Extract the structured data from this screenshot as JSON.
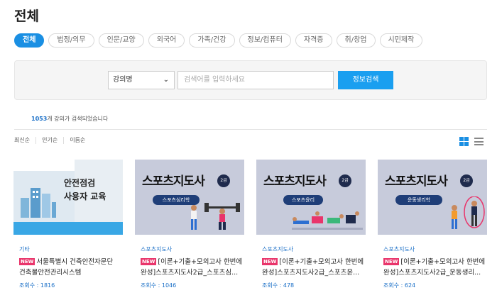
{
  "page_title": "전체",
  "tabs": [
    "전체",
    "법정/의무",
    "인문/교양",
    "외국어",
    "가족/건강",
    "정보/컴퓨터",
    "자격증",
    "취/창업",
    "시민제작"
  ],
  "search": {
    "select_value": "강의명",
    "input_placeholder": "검색어를 입력하세요",
    "button_label": "정보검색"
  },
  "result": {
    "count": "1053",
    "suffix": "개 강의가 검색되었습니다"
  },
  "sort_options": [
    "최신순",
    "인기순",
    "이름순"
  ],
  "cards": [
    {
      "thumb": {
        "line1": "안전점검",
        "line2": "사용자 교육"
      },
      "category": "기타",
      "new_badge": "NEW",
      "title": "서울특별시 건축안전자문단 건축물안전관리시스템",
      "views": "조회수 : 1816"
    },
    {
      "thumb": {
        "headline": "스포츠지도사",
        "grade": "2급",
        "pill": "스포츠심리학"
      },
      "category": "스포츠지도사",
      "new_badge": "NEW",
      "title": "[이론+기출+모의고사 한번에 완성]스포츠지도사2급_스포츠심...",
      "views": "조회수 : 1046"
    },
    {
      "thumb": {
        "headline": "스포츠지도사",
        "grade": "2급",
        "pill": "스포츠윤리"
      },
      "category": "스포츠지도사",
      "new_badge": "NEW",
      "title": "[이론+기출+모의고사 한번에 완성]스포츠지도사2급_스포츠윤...",
      "views": "조회수 : 478"
    },
    {
      "thumb": {
        "headline": "스포츠지도사",
        "grade": "2급",
        "pill": "운동생리학"
      },
      "category": "스포츠지도사",
      "new_badge": "NEW",
      "title": "[이론+기출+모의고사 한번에 완성]스포츠지도사2급_운동생리...",
      "views": "조회수 : 624"
    }
  ],
  "colors": {
    "accent": "#1a8fe3",
    "new_badge": "#e9356b",
    "link": "#1a6fc7"
  }
}
